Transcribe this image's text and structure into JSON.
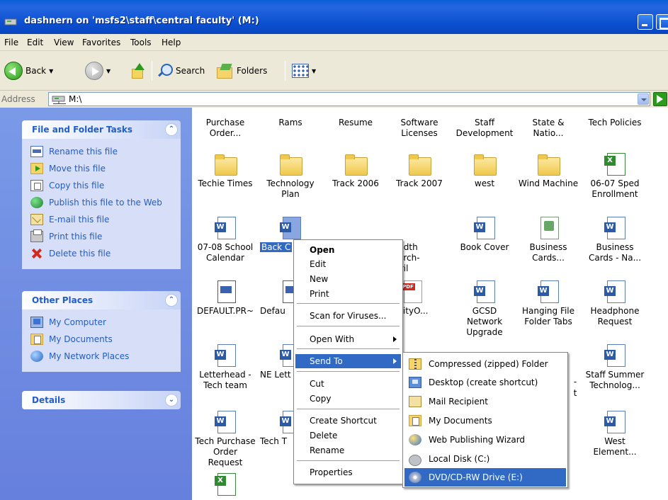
{
  "window": {
    "title": "dashnern on 'msfs2\\staff\\central faculty' (M:)"
  },
  "menubar": [
    "File",
    "Edit",
    "View",
    "Favorites",
    "Tools",
    "Help"
  ],
  "toolbar": {
    "back_label": "Back",
    "search_label": "Search",
    "folders_label": "Folders"
  },
  "address": {
    "label": "Address",
    "value": "M:\\"
  },
  "file_tasks": {
    "title": "File and Folder Tasks",
    "items": [
      {
        "label": "Rename this file",
        "icon": "rename-icon"
      },
      {
        "label": "Move this file",
        "icon": "move-icon"
      },
      {
        "label": "Copy this file",
        "icon": "copy-icon"
      },
      {
        "label": "Publish this file to the Web",
        "icon": "globe-icon"
      },
      {
        "label": "E-mail this file",
        "icon": "email-icon"
      },
      {
        "label": "Print this file",
        "icon": "printer-icon"
      },
      {
        "label": "Delete this file",
        "icon": "delete-icon"
      }
    ]
  },
  "other_places": {
    "title": "Other Places",
    "items": [
      {
        "label": "My Computer",
        "icon": "my-computer-icon"
      },
      {
        "label": "My Documents",
        "icon": "my-documents-icon"
      },
      {
        "label": "My Network Places",
        "icon": "network-places-icon"
      }
    ]
  },
  "details": {
    "title": "Details"
  },
  "files": {
    "row1": [
      "Purchase Order...",
      "Rams",
      "Resume",
      "Software Licenses",
      "Staff Development",
      "State & Natio...",
      "Tech Policies"
    ],
    "row2": [
      "Techie Times",
      "Technology Plan",
      "Track 2006",
      "Track 2007",
      "west",
      "Wind Machine",
      "06-07 Sped Enrollment"
    ],
    "row3": [
      "07-08 School Calendar",
      "Back C",
      "dwidth for rch-April",
      "Book Cover",
      "Business Cards...",
      "Business Cards - Na..."
    ],
    "row4": [
      "DEFAULT.PR~",
      "Defau",
      "egrityO...",
      "GCSD Network Upgrade",
      "Hanging File Folder Tabs",
      "Headphone Request"
    ],
    "row5": [
      "Letterhead - Tech team",
      "NE Lett",
      "-",
      "t",
      "Staff Summer Technolog..."
    ],
    "row6": [
      "Tech Purchase Order Request",
      "Tech T",
      "West Element..."
    ]
  },
  "context_menu": {
    "items": [
      "Open",
      "Edit",
      "New",
      "Print",
      "Scan for Viruses...",
      "Open With",
      "Send To",
      "Cut",
      "Copy",
      "Create Shortcut",
      "Delete",
      "Rename",
      "Properties"
    ]
  },
  "send_to": {
    "items": [
      {
        "label": "Compressed (zipped) Folder",
        "icon": "zip-folder-icon"
      },
      {
        "label": "Desktop (create shortcut)",
        "icon": "desktop-icon"
      },
      {
        "label": "Mail Recipient",
        "icon": "mail-icon"
      },
      {
        "label": "My Documents",
        "icon": "my-documents-icon"
      },
      {
        "label": "Web Publishing Wizard",
        "icon": "web-publish-icon"
      },
      {
        "label": "Local Disk (C:)",
        "icon": "local-disk-icon"
      },
      {
        "label": "DVD/CD-RW Drive (E:)",
        "icon": "dvd-drive-icon"
      }
    ]
  },
  "colors": {
    "titlebar": "#0b4fcf",
    "selection": "#316ac5",
    "task_pane": "#6b8ae2",
    "task_link": "#215dc6"
  }
}
